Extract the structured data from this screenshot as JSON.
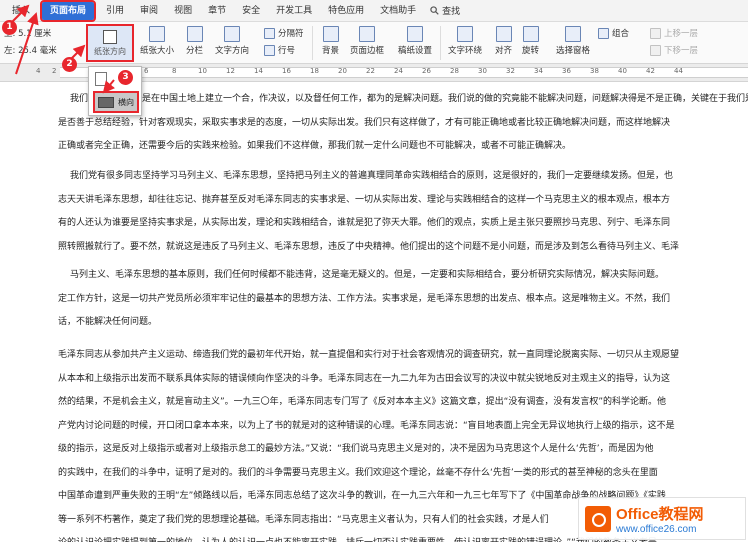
{
  "menu": {
    "items": [
      "插入",
      "页面布局",
      "引用",
      "审阅",
      "视图",
      "章节",
      "安全",
      "开发工具",
      "特色应用",
      "文档助手"
    ],
    "active_index": 1,
    "search_label": "查找"
  },
  "ribbon": {
    "margin_top": "上: 5.1 厘米",
    "margin_left": "左: 25.4 毫米",
    "orientation": "纸张方向",
    "size": "纸张大小",
    "columns": "分栏",
    "text_direction": "文字方向",
    "hyphenation": "分隔符",
    "line_numbers": "行号",
    "background": "背景",
    "page_border": "页面边框",
    "draft_settings": "稿纸设置",
    "text_wrap": "文字环绕",
    "align": "对齐",
    "rotate": "旋转",
    "selection_pane": "选择窗格",
    "group": "组合",
    "bring_forward": "上移一层",
    "send_backward": "下移一层"
  },
  "ruler": {
    "numbers": [
      "4",
      "2",
      "2",
      "4",
      "6",
      "8",
      "10",
      "12",
      "14",
      "16",
      "18",
      "20",
      "22",
      "24",
      "26",
      "28",
      "30",
      "32",
      "34",
      "36",
      "38",
      "40",
      "42",
      "44"
    ]
  },
  "dropdown": {
    "landscape_label": "横向"
  },
  "steps": [
    "1",
    "2",
    "3"
  ],
  "document": {
    "paragraphs": [
      [
        "我们的第一个任务是在中国土地上建立一个合，作决议，以及督任何工作，都为的是解决问题。我们说的做的究竟能不能解决问题，问题解决得是不是正确，关键在于我们是否能够",
        "是否善于总结经验，针对客观现实，采取实事求是的态度，一切从实际出发。我们只有这样做了，才有可能正确地或者比较正确地解决问题，而这样地解决",
        "正确或者完全正确，还需要今后的实践来检验。如果我们不这样做，那我们就一定什么问题也不可能解决，或者不可能正确解决。"
      ],
      [
        "我们党有很多同志坚持学习马列主义、毛泽东思想，坚持把马列主义的普遍真理同革命实践相结合的原则，这是很好的，我们一定要继续发扬。但是，也",
        "志天天讲毛泽东思想，却往往忘记、抛弃甚至反对毛泽东同志的实事求是、一切从实际出发、理论与实践相结合的这样一个马克思主义的根本观点，根本方",
        "有的人还认为谁要是坚持实事求是，从实际出发，理论和实践相结合，谁就是犯了弥天大罪。他们的观点，实质上是主张只要照抄马克思、列宁、毛泽东同",
        "照转照搬就行了。要不然，就说这是违反了马列主义、毛泽东思想，违反了中央精神。他们提出的这个问题不是小问题，而是涉及到怎么看待马列主义、毛泽"
      ],
      [
        "马列主义、毛泽东思想的基本原则，我们任何时候都不能违背，这是毫无疑义的。但是，一定要和实际相结合，要分析研究实际情况，解决实际问题。",
        "定工作方针，这是一切共产党员所必须牢牢记住的最基本的思想方法、工作方法。实事求是，是毛泽东思想的出发点、根本点。这是唯物主义。不然，我们",
        "话，不能解决任何问题。"
      ],
      [
        "毛泽东同志从参加共产主义运动、缔造我们党的最初年代开始，就一直提倡和实行对于社会客观情况的调查研究，就一直同理论脱离实际、一切只从主观愿望",
        "从本本和上级指示出发而不联系具体实际的错误倾向作坚决的斗争。毛泽东同志在一九二九年为古田会议写的决议中就尖锐地反对主观主义的指导，认为这",
        "然的结果，不是机会主义，就是盲动主义”。一九三〇年，毛泽东同志专门写了《反对本本主义》这篇文章，提出“没有调查，没有发言权”的科学论断。他",
        "产党内讨论问题的时候，开口闭口拿本本来，以为上了书的就是对的这种错误的心理。毛泽东同志说：“盲目地表面上完全无异议地执行上级的指示，这不是",
        "级的指示，这是反对上级指示或者对上级指示怠工的最妙方法。”又说：“我们说马克思主义是对的，决不是因为马克思这个人是什么‘先哲’，而是因为他",
        "的实践中，在我们的斗争中，证明了是对的。我们的斗争需要马克思主义。我们欢迎这个理论，丝毫不存什么‘先哲’一类的形式的甚至神秘的念头在里面",
        "中国革命遭到严重失败的王明“左”倾路线以后，毛泽东同志总结了这次斗争的教训，在一九三六年和一九三七年写下了《中国革命战争的战略问题》《实践",
        "等一系列不朽著作，奠定了我们党的思想理论基础。毛泽东同志指出：“马克思主义者认为，只有人们的社会实践，才是人们",
        "论的认识论把实践提到第一的地位，认为人的认识一点也不能离开实践，排斥一切否认实践重要性，使认识离开实践的错误理论。”“我们的教条主义者是"
      ]
    ]
  },
  "watermark": {
    "title": "Office教程网",
    "url": "www.office26.com"
  },
  "colors": {
    "accent": "#2f6fd6",
    "highlight_red": "#e8262d",
    "watermark_orange": "#f25c05"
  }
}
